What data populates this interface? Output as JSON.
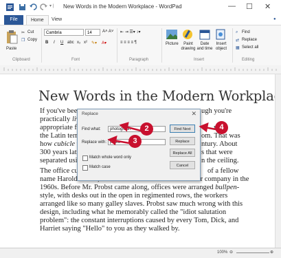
{
  "window": {
    "title": "New Words in the Modern Workplace - WordPad",
    "min_glyph": "—",
    "max_glyph": "☐",
    "close_glyph": "✕"
  },
  "ribbon": {
    "tabs": [
      "File",
      "Home",
      "View"
    ],
    "clipboard": {
      "paste": "Paste",
      "cut": "Cut",
      "copy": "Copy",
      "label": "Clipboard"
    },
    "font": {
      "family": "Cambria",
      "size": "14",
      "label": "Font"
    },
    "paragraph": {
      "label": "Paragraph"
    },
    "insert": {
      "picture": "Picture",
      "paint": "Paint drawing",
      "datetime": "Date and time",
      "object": "Insert object",
      "label": "Insert"
    },
    "editing": {
      "find": "Find",
      "replace": "Replace",
      "select_all": "Select all",
      "label": "Editing"
    }
  },
  "document": {
    "heading": "New Words in the Modern Workplace",
    "para1_lines": [
      "If you've been",
      "practically liv",
      "appropriate fo",
      "the Latin term cu",
      "how cubicle w",
      "300 years late",
      "separated usi"
    ],
    "para1_right": [
      "ugh you're",
      "",
      "n the",
      "om. That was",
      "ntury. About",
      "s that were",
      "n the ceiling."
    ],
    "para2_lines": [
      "The office cubi",
      "name Harold Probst, who worked for the Herman Miller company in the",
      "1960s. Before Mr. Probst came along, offices were arranged bullpen-",
      "style, with desks out in the open in regimented rows, the workers",
      "arranged like so many galley slaves. Probst saw much wrong with this",
      "design, including what he memorably called the \"idiot salutation",
      "problem\": the constant interruptions caused by every Tom, Dick, and",
      "Harriet saying \"Hello\" to you as they walked by."
    ],
    "para2_right": "of a fellow"
  },
  "dialog": {
    "title": "Replace",
    "find_label": "Find what:",
    "find_value": "photograph",
    "replace_label": "Replace with:",
    "replace_value": "photo",
    "whole_word": "Match whole word only",
    "match_case": "Match case",
    "buttons": [
      "Find Next",
      "Replace",
      "Replace All",
      "Cancel"
    ]
  },
  "callouts": [
    "2",
    "3",
    "4"
  ],
  "status": {
    "zoom": "100%"
  },
  "colors": {
    "accent": "#2b5797",
    "callout": "#c8102e"
  }
}
